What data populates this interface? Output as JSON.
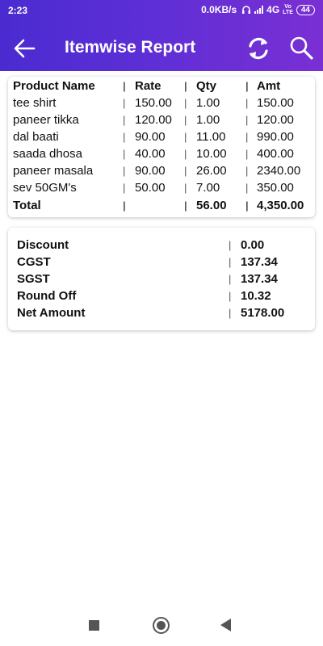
{
  "status_bar": {
    "time": "2:23",
    "net_speed": "0.0KB/s",
    "network": "4G",
    "volte_top": "Vo",
    "volte_bottom": "LTE",
    "battery": "44"
  },
  "toolbar": {
    "title": "Itemwise Report",
    "back_icon": "arrow-left-icon",
    "refresh_icon": "refresh-icon",
    "search_icon": "search-icon"
  },
  "table": {
    "headers": {
      "name": "Product Name",
      "rate": "Rate",
      "qty": "Qty",
      "amt": "Amt"
    },
    "separator": "|",
    "rows": [
      {
        "name": "tee shirt",
        "rate": "150.00",
        "qty": "1.00",
        "amt": "150.00"
      },
      {
        "name": "paneer tikka",
        "rate": "120.00",
        "qty": "1.00",
        "amt": "120.00"
      },
      {
        "name": "dal baati",
        "rate": "90.00",
        "qty": "11.00",
        "amt": "990.00"
      },
      {
        "name": "saada dhosa",
        "rate": "40.00",
        "qty": "10.00",
        "amt": "400.00"
      },
      {
        "name": "paneer masala",
        "rate": "90.00",
        "qty": "26.00",
        "amt": "2340.00"
      },
      {
        "name": "sev 50GM's",
        "rate": "50.00",
        "qty": "7.00",
        "amt": "350.00"
      }
    ],
    "total": {
      "label": "Total",
      "qty": "56.00",
      "amt": "4,350.00"
    }
  },
  "summary": {
    "separator": "|",
    "items": [
      {
        "label": "Discount",
        "value": "0.00"
      },
      {
        "label": "CGST",
        "value": "137.34"
      },
      {
        "label": "SGST",
        "value": "137.34"
      },
      {
        "label": "Round Off",
        "value": "10.32"
      },
      {
        "label": "Net Amount",
        "value": "5178.00"
      }
    ]
  },
  "colors": {
    "appbar_start": "#4a2bd0",
    "appbar_end": "#7a2fd3",
    "text": "#111111"
  },
  "nav": {
    "recents_icon": "square-icon",
    "home_icon": "circle-home-icon",
    "back_icon": "triangle-back-icon"
  }
}
